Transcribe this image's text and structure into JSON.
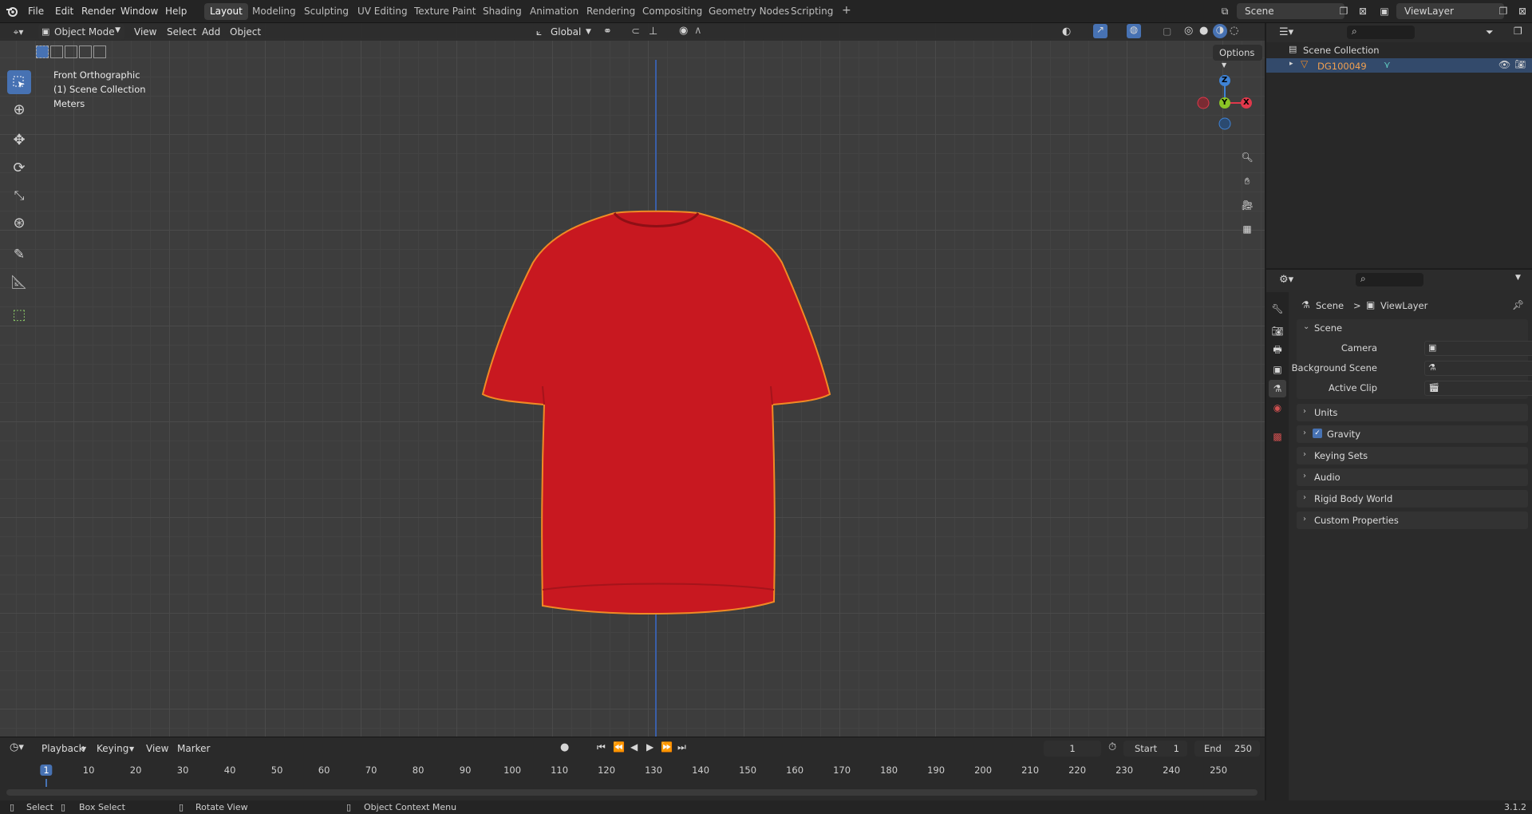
{
  "menu": {
    "blender_logo": "blender-logo",
    "file": "File",
    "edit": "Edit",
    "render": "Render",
    "window": "Window",
    "help": "Help"
  },
  "workspaces": [
    "Layout",
    "Modeling",
    "Sculpting",
    "UV Editing",
    "Texture Paint",
    "Shading",
    "Animation",
    "Rendering",
    "Compositing",
    "Geometry Nodes",
    "Scripting"
  ],
  "workspace_add": "+",
  "scene_field": "Scene",
  "viewlayer_field": "ViewLayer",
  "viewport": {
    "mode": "Object Mode",
    "menus": [
      "View",
      "Select",
      "Add",
      "Object"
    ],
    "orientation": "Global",
    "options": "Options",
    "overlay": {
      "view": "Front Orthographic",
      "collection": "(1) Scene Collection",
      "units": "Meters"
    },
    "gizmo": {
      "z": "Z",
      "y": "Y",
      "x": "X"
    }
  },
  "outliner": {
    "root": "Scene Collection",
    "object": "DG100049"
  },
  "properties": {
    "breadcrumb_scene": "Scene",
    "breadcrumb_sep": ">",
    "breadcrumb_viewlayer": "ViewLayer",
    "scene_panel": "Scene",
    "camera_label": "Camera",
    "background_scene_label": "Background Scene",
    "active_clip_label": "Active Clip",
    "panels": [
      "Units",
      "Gravity",
      "Keying Sets",
      "Audio",
      "Rigid Body World",
      "Custom Properties"
    ],
    "gravity_checked": true
  },
  "timeline": {
    "menus": [
      "Playback",
      "Keying",
      "View",
      "Marker"
    ],
    "current_frame": "1",
    "start_label": "Start",
    "start_value": "1",
    "end_label": "End",
    "end_value": "250",
    "ticks": [
      "1",
      "10",
      "20",
      "30",
      "40",
      "50",
      "60",
      "70",
      "80",
      "90",
      "100",
      "110",
      "120",
      "130",
      "140",
      "150",
      "160",
      "170",
      "180",
      "190",
      "200",
      "210",
      "220",
      "230",
      "240",
      "250"
    ]
  },
  "status": {
    "select": "Select",
    "box_select": "Box Select",
    "rotate_view": "Rotate View",
    "context_menu": "Object Context Menu",
    "version": "3.1.2"
  },
  "colors": {
    "accent": "#4772b3",
    "selection_outline": "#f08a24",
    "shirt": "#c81820",
    "axis_x": "#e0384b",
    "axis_y": "#8bc526",
    "axis_z": "#3f83d6"
  }
}
